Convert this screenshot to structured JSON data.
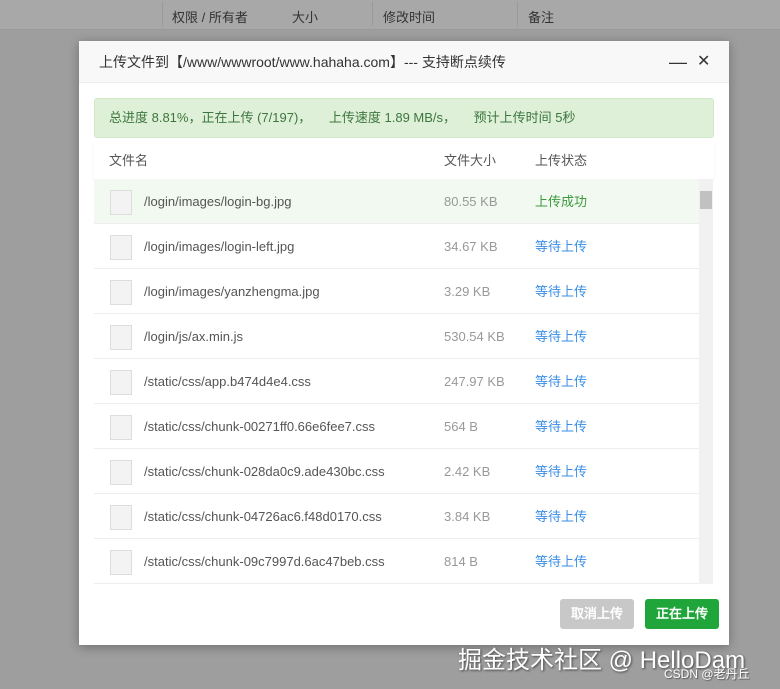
{
  "background_header": [
    "权限 / 所有者",
    "大小",
    "修改时间",
    "备注"
  ],
  "dialog": {
    "title": "上传文件到【/www/wwwroot/www.hahaha.com】--- 支持断点续传",
    "minimize": "—",
    "close": "✕"
  },
  "progress": {
    "total": "总进度 8.81%，正在上传 (7/197)，",
    "speed": "上传速度 1.89 MB/s，",
    "eta": "预计上传时间 5秒",
    "percent": 8.81
  },
  "columns": {
    "name": "文件名",
    "size": "文件大小",
    "status": "上传状态"
  },
  "files": [
    {
      "name": "/login/images/login-bg.jpg",
      "size": "80.55 KB",
      "status": "上传成功"
    },
    {
      "name": "/login/images/login-left.jpg",
      "size": "34.67 KB",
      "status": "等待上传"
    },
    {
      "name": "/login/images/yanzhengma.jpg",
      "size": "3.29 KB",
      "status": "等待上传"
    },
    {
      "name": "/login/js/ax.min.js",
      "size": "530.54 KB",
      "status": "等待上传"
    },
    {
      "name": "/static/css/app.b474d4e4.css",
      "size": "247.97 KB",
      "status": "等待上传"
    },
    {
      "name": "/static/css/chunk-00271ff0.66e6fee7.css",
      "size": "564 B",
      "status": "等待上传"
    },
    {
      "name": "/static/css/chunk-028da0c9.ade430bc.css",
      "size": "2.42 KB",
      "status": "等待上传"
    },
    {
      "name": "/static/css/chunk-04726ac6.f48d0170.css",
      "size": "3.84 KB",
      "status": "等待上传"
    },
    {
      "name": "/static/css/chunk-09c7997d.6ac47beb.css",
      "size": "814 B",
      "status": "等待上传"
    }
  ],
  "buttons": {
    "cancel": "取消上传",
    "uploading": "正在上传"
  },
  "watermark": {
    "main": "掘金技术社区 @ HelloDam",
    "sub": "CSDN @老丹丘"
  },
  "colors": {
    "success": "#3c9a3c",
    "waiting": "#3a8ee6",
    "primary": "#20a53a",
    "disabled": "#c8c8c8"
  }
}
